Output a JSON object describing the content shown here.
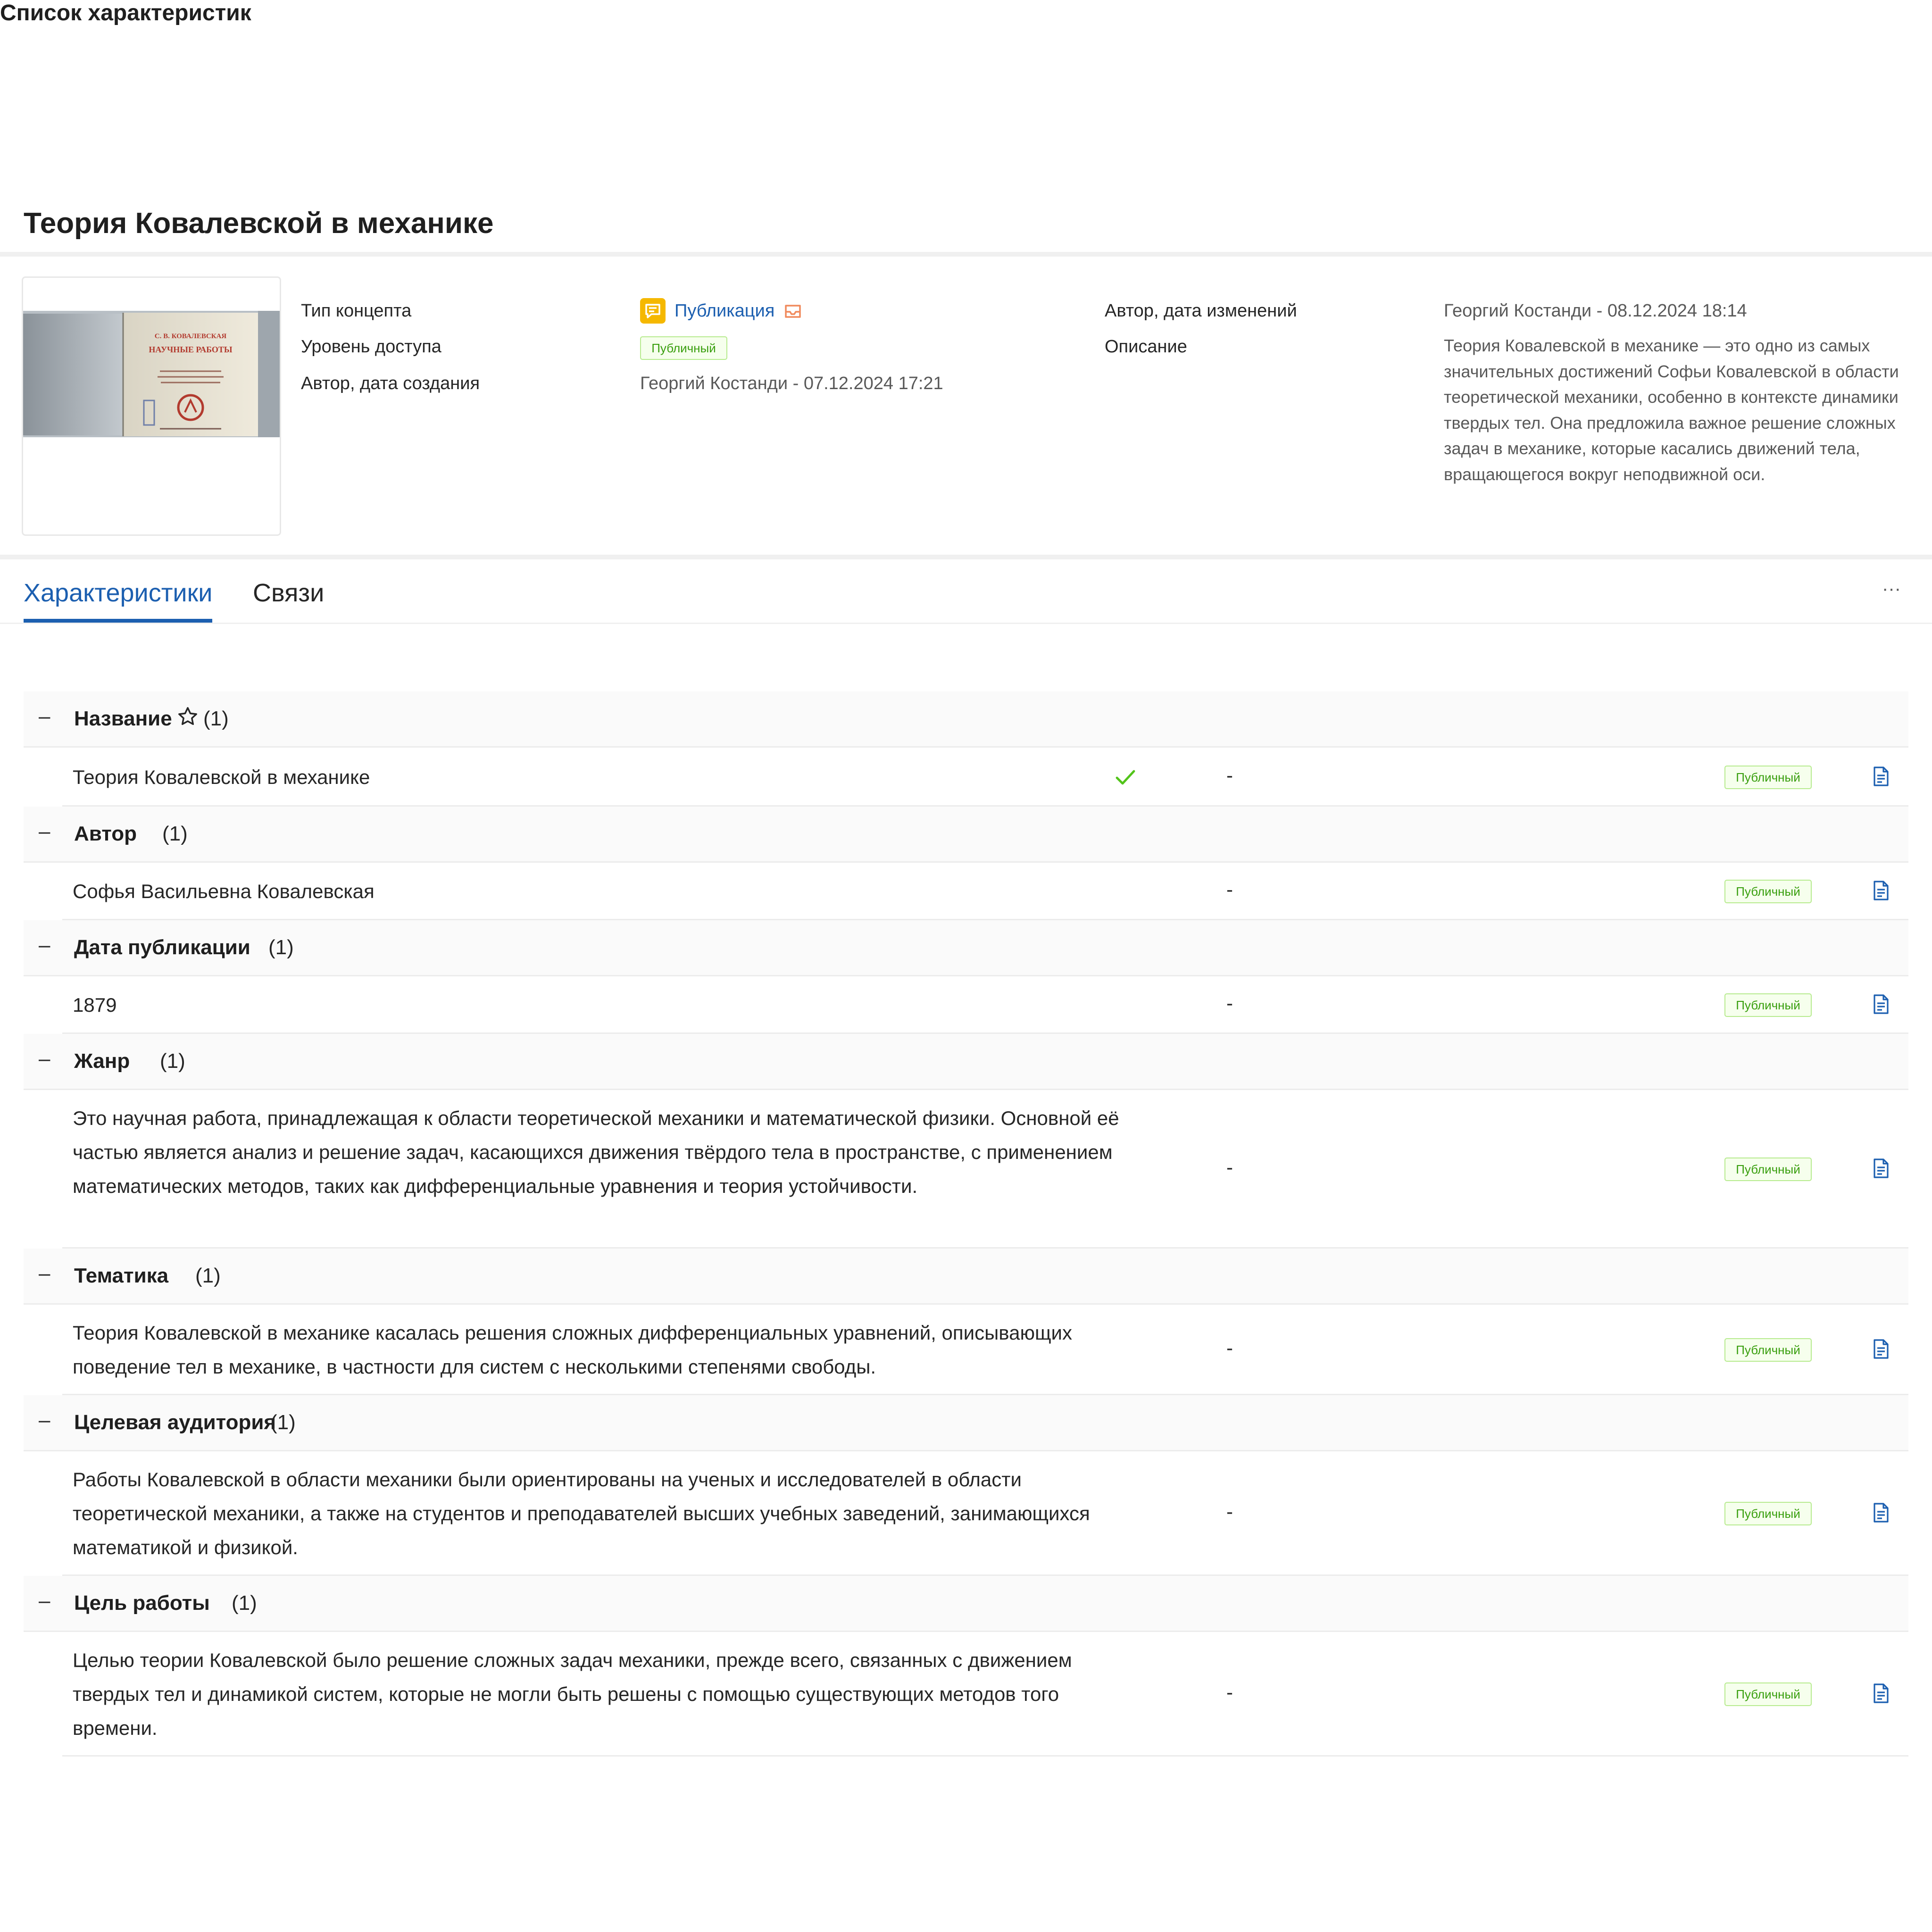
{
  "page": {
    "title": "Теория Ковалевской в механике"
  },
  "thumbnail": {
    "book_author": "С. В. КОВАЛЕВСКАЯ",
    "book_title": "НАУЧНЫЕ РАБОТЫ"
  },
  "meta": {
    "concept_type_label": "Тип концепта",
    "concept_type_value": "Публикация",
    "access_level_label": "Уровень доступа",
    "access_level_value": "Публичный",
    "created_label": "Автор, дата создания",
    "created_value": "Георгий  Костанди - 07.12.2024 17:21",
    "modified_label": "Автор, дата изменений",
    "modified_value": "Георгий  Костанди - 08.12.2024 18:14",
    "description_label": "Описание",
    "description_value": "Теория Ковалевской в механике — это одно из самых значительных достижений Софьи Ковалевской в области теоретической механики, особенно в контексте динамики твердых тел. Она предложила важное решение сложных задач в механике, которые касались движений тела, вращающегося вокруг неподвижной оси."
  },
  "tabs": {
    "characteristics": "Характеристики",
    "links": "Связи",
    "more": "···"
  },
  "section_title": "Список характеристик",
  "groups": [
    {
      "minus": "–",
      "title": "Название",
      "starred": true,
      "count": "(1)",
      "value": "Теория Ковалевской в механике",
      "checked": true,
      "dash": "-",
      "access": "Публичный"
    },
    {
      "minus": "–",
      "title": "Автор",
      "starred": false,
      "count": "(1)",
      "value": "Софья Васильевна Ковалевская",
      "checked": false,
      "dash": "-",
      "access": "Публичный"
    },
    {
      "minus": "–",
      "title": "Дата публикации",
      "starred": false,
      "count": "(1)",
      "value": "1879",
      "checked": false,
      "dash": "-",
      "access": "Публичный"
    },
    {
      "minus": "–",
      "title": "Жанр",
      "starred": false,
      "count": "(1)",
      "value": "Это научная работа, принадлежащая к области теоретической механики и математической физики. Основной её частью является анализ и решение задач, касающихся движения твёрдого тела в пространстве, с применением математических методов, таких как дифференциальные уравнения и теория устойчивости.",
      "checked": false,
      "dash": "-",
      "access": "Публичный"
    },
    {
      "minus": "–",
      "title": "Тематика",
      "starred": false,
      "count": "(1)",
      "value": "Теория Ковалевской в механике касалась решения сложных дифференциальных уравнений, описывающих поведение тел в механике, в частности для систем с несколькими степенями свободы.",
      "checked": false,
      "dash": "-",
      "access": "Публичный"
    },
    {
      "minus": "–",
      "title": "Целевая аудитория",
      "starred": false,
      "count": "(1)",
      "value": "Работы Ковалевской в области механики были ориентированы на ученых и исследователей в области теоретической механики, а также на студентов и преподавателей высших учебных заведений, занимающихся математикой и физикой.",
      "checked": false,
      "dash": "-",
      "access": "Публичный"
    },
    {
      "minus": "–",
      "title": "Цель работы",
      "starred": false,
      "count": "(1)",
      "value": "Целью теории Ковалевской было решение сложных задач механики, прежде всего, связанных с движением твердых тел и динамикой систем, которые не могли быть решены с помощью существующих методов того времени.",
      "checked": false,
      "dash": "-",
      "access": "Публичный"
    }
  ],
  "colors": {
    "accent": "#1c5fb0",
    "tag_green_text": "#389e0d",
    "tag_green_border": "#b7eb8f",
    "check_green": "#52c41a",
    "type_icon_yellow": "#f5b800",
    "inbox_icon_orange": "#f08a5d"
  },
  "icons": {
    "type": "message-square-icon",
    "inbox": "inbox-icon",
    "star": "star-outline-icon",
    "check": "check-icon",
    "doc": "document-icon",
    "collapse": "minus-icon"
  }
}
